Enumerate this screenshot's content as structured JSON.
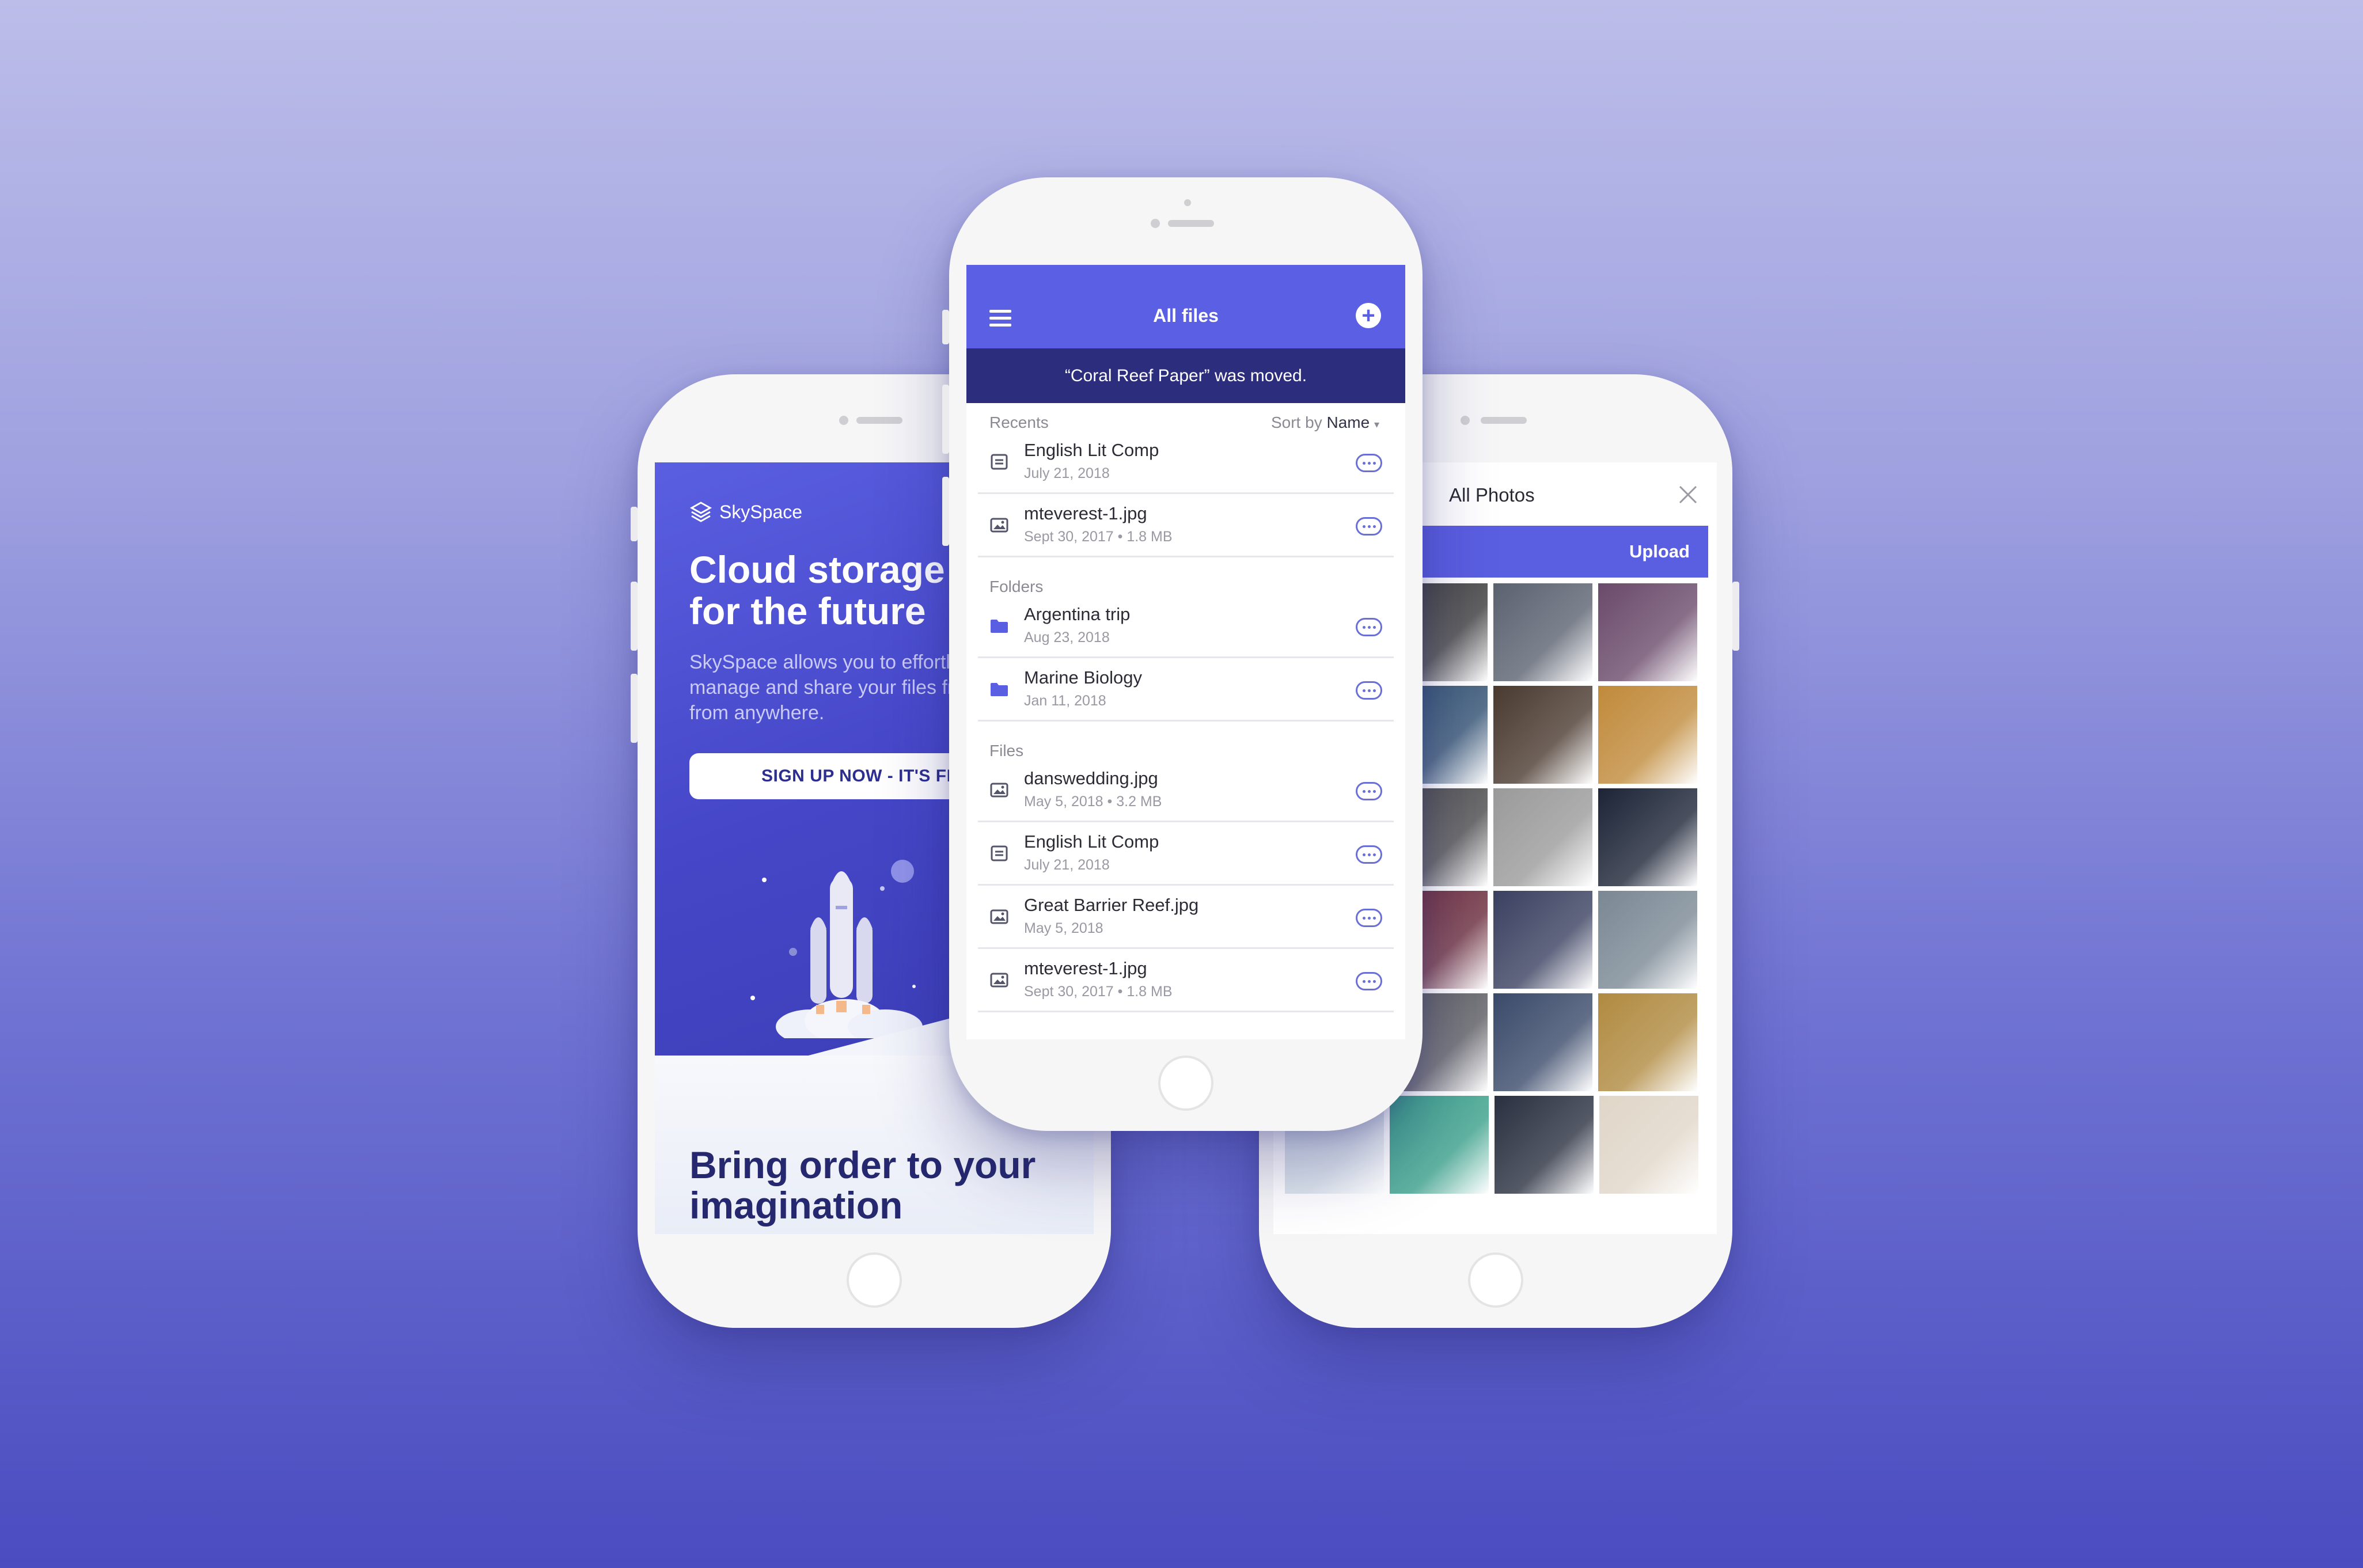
{
  "left_phone": {
    "brand": "SkySpace",
    "headline": "Cloud storage for the future",
    "description": "SkySpace allows you to effortlessly create, manage and share your files from any device, from anywhere.",
    "cta": "SIGN UP NOW - IT'S FREE",
    "bottom_headline": "Bring order to your imagination"
  },
  "center_phone": {
    "title": "All files",
    "toast": "“Coral Reef Paper” was moved.",
    "sort_label": "Sort by",
    "sort_value": "Name",
    "sections": {
      "recents": "Recents",
      "folders": "Folders",
      "files": "Files"
    },
    "recents": [
      {
        "name": "English Lit Comp",
        "meta": "July 21, 2018",
        "icon": "document-icon"
      },
      {
        "name": "mteverest-1.jpg",
        "meta": "Sept 30, 2017 • 1.8 MB",
        "icon": "image-icon"
      }
    ],
    "folders": [
      {
        "name": "Argentina trip",
        "meta": "Aug 23, 2018",
        "icon": "folder-icon"
      },
      {
        "name": "Marine Biology",
        "meta": "Jan 11, 2018",
        "icon": "folder-icon"
      }
    ],
    "files": [
      {
        "name": "danswedding.jpg",
        "meta": "May 5, 2018 • 3.2 MB",
        "icon": "image-icon"
      },
      {
        "name": "English Lit Comp",
        "meta": "July 21, 2018",
        "icon": "document-icon"
      },
      {
        "name": "Great Barrier Reef.jpg",
        "meta": "May 5, 2018",
        "icon": "image-icon"
      },
      {
        "name": "mteverest-1.jpg",
        "meta": "Sept 30, 2017 • 1.8 MB",
        "icon": "image-icon"
      }
    ]
  },
  "right_phone": {
    "title": "All Photos",
    "upload": "Upload",
    "photo_colors": [
      [
        "#3a3a3a",
        "#5b6270",
        "#6a4a6a"
      ],
      [
        "#2f4f70",
        "#4a3a30",
        "#c08a3a"
      ],
      [
        "#4a4a4a",
        "#9a9a9a",
        "#1c2436"
      ],
      [
        "#6a2a3a",
        "#3a4060",
        "#7a8894"
      ],
      [
        "#5a5a60",
        "#3a4a6a",
        "#b08a40"
      ],
      [
        "#d6e0e8",
        "#3aa08a",
        "#2a3040",
        "#e0d6c8"
      ]
    ]
  },
  "accent": "#5a5ee0"
}
